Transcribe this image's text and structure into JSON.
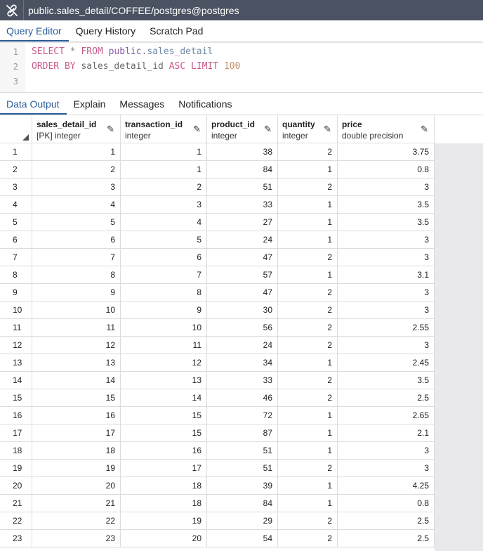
{
  "title": "public.sales_detail/COFFEE/postgres@postgres",
  "icons": {
    "connection": "connection-icon",
    "edit": "pencil-icon"
  },
  "editor_tabs": [
    "Query Editor",
    "Query History",
    "Scratch Pad"
  ],
  "active_editor_tab": 0,
  "query": {
    "line_numbers": [
      "1",
      "2",
      "3"
    ],
    "line1": {
      "select": "SELECT",
      "star": "*",
      "from": "FROM",
      "schema": "public",
      "dot": ".",
      "table": "sales_detail"
    },
    "line2": {
      "order_by": "ORDER BY",
      "column": "sales_detail_id",
      "asc": "ASC",
      "limit": "LIMIT",
      "limit_value": "100"
    }
  },
  "output_tabs": [
    "Data Output",
    "Explain",
    "Messages",
    "Notifications"
  ],
  "active_output_tab": 0,
  "columns": [
    {
      "name": "sales_detail_id",
      "type": "[PK] integer"
    },
    {
      "name": "transaction_id",
      "type": "integer"
    },
    {
      "name": "product_id",
      "type": "integer"
    },
    {
      "name": "quantity",
      "type": "integer"
    },
    {
      "name": "price",
      "type": "double precision"
    }
  ],
  "rows": [
    [
      "1",
      "1",
      "1",
      "38",
      "2",
      "3.75"
    ],
    [
      "2",
      "2",
      "1",
      "84",
      "1",
      "0.8"
    ],
    [
      "3",
      "3",
      "2",
      "51",
      "2",
      "3"
    ],
    [
      "4",
      "4",
      "3",
      "33",
      "1",
      "3.5"
    ],
    [
      "5",
      "5",
      "4",
      "27",
      "1",
      "3.5"
    ],
    [
      "6",
      "6",
      "5",
      "24",
      "1",
      "3"
    ],
    [
      "7",
      "7",
      "6",
      "47",
      "2",
      "3"
    ],
    [
      "8",
      "8",
      "7",
      "57",
      "1",
      "3.1"
    ],
    [
      "9",
      "9",
      "8",
      "47",
      "2",
      "3"
    ],
    [
      "10",
      "10",
      "9",
      "30",
      "2",
      "3"
    ],
    [
      "11",
      "11",
      "10",
      "56",
      "2",
      "2.55"
    ],
    [
      "12",
      "12",
      "11",
      "24",
      "2",
      "3"
    ],
    [
      "13",
      "13",
      "12",
      "34",
      "1",
      "2.45"
    ],
    [
      "14",
      "14",
      "13",
      "33",
      "2",
      "3.5"
    ],
    [
      "15",
      "15",
      "14",
      "46",
      "2",
      "2.5"
    ],
    [
      "16",
      "16",
      "15",
      "72",
      "1",
      "2.65"
    ],
    [
      "17",
      "17",
      "15",
      "87",
      "1",
      "2.1"
    ],
    [
      "18",
      "18",
      "16",
      "51",
      "1",
      "3"
    ],
    [
      "19",
      "19",
      "17",
      "51",
      "2",
      "3"
    ],
    [
      "20",
      "20",
      "18",
      "39",
      "1",
      "4.25"
    ],
    [
      "21",
      "21",
      "18",
      "84",
      "1",
      "0.8"
    ],
    [
      "22",
      "22",
      "19",
      "29",
      "2",
      "2.5"
    ],
    [
      "23",
      "23",
      "20",
      "54",
      "2",
      "2.5"
    ]
  ]
}
